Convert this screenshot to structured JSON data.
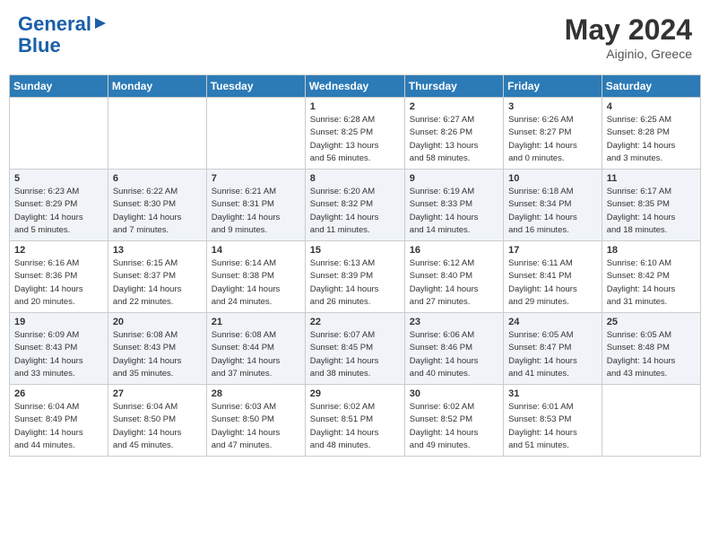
{
  "header": {
    "logo_text_general": "General",
    "logo_text_blue": "Blue",
    "month_year": "May 2024",
    "location": "Aiginio, Greece"
  },
  "weekdays": [
    "Sunday",
    "Monday",
    "Tuesday",
    "Wednesday",
    "Thursday",
    "Friday",
    "Saturday"
  ],
  "weeks": [
    [
      {
        "day": "",
        "info": ""
      },
      {
        "day": "",
        "info": ""
      },
      {
        "day": "",
        "info": ""
      },
      {
        "day": "1",
        "info": "Sunrise: 6:28 AM\nSunset: 8:25 PM\nDaylight: 13 hours\nand 56 minutes."
      },
      {
        "day": "2",
        "info": "Sunrise: 6:27 AM\nSunset: 8:26 PM\nDaylight: 13 hours\nand 58 minutes."
      },
      {
        "day": "3",
        "info": "Sunrise: 6:26 AM\nSunset: 8:27 PM\nDaylight: 14 hours\nand 0 minutes."
      },
      {
        "day": "4",
        "info": "Sunrise: 6:25 AM\nSunset: 8:28 PM\nDaylight: 14 hours\nand 3 minutes."
      }
    ],
    [
      {
        "day": "5",
        "info": "Sunrise: 6:23 AM\nSunset: 8:29 PM\nDaylight: 14 hours\nand 5 minutes."
      },
      {
        "day": "6",
        "info": "Sunrise: 6:22 AM\nSunset: 8:30 PM\nDaylight: 14 hours\nand 7 minutes."
      },
      {
        "day": "7",
        "info": "Sunrise: 6:21 AM\nSunset: 8:31 PM\nDaylight: 14 hours\nand 9 minutes."
      },
      {
        "day": "8",
        "info": "Sunrise: 6:20 AM\nSunset: 8:32 PM\nDaylight: 14 hours\nand 11 minutes."
      },
      {
        "day": "9",
        "info": "Sunrise: 6:19 AM\nSunset: 8:33 PM\nDaylight: 14 hours\nand 14 minutes."
      },
      {
        "day": "10",
        "info": "Sunrise: 6:18 AM\nSunset: 8:34 PM\nDaylight: 14 hours\nand 16 minutes."
      },
      {
        "day": "11",
        "info": "Sunrise: 6:17 AM\nSunset: 8:35 PM\nDaylight: 14 hours\nand 18 minutes."
      }
    ],
    [
      {
        "day": "12",
        "info": "Sunrise: 6:16 AM\nSunset: 8:36 PM\nDaylight: 14 hours\nand 20 minutes."
      },
      {
        "day": "13",
        "info": "Sunrise: 6:15 AM\nSunset: 8:37 PM\nDaylight: 14 hours\nand 22 minutes."
      },
      {
        "day": "14",
        "info": "Sunrise: 6:14 AM\nSunset: 8:38 PM\nDaylight: 14 hours\nand 24 minutes."
      },
      {
        "day": "15",
        "info": "Sunrise: 6:13 AM\nSunset: 8:39 PM\nDaylight: 14 hours\nand 26 minutes."
      },
      {
        "day": "16",
        "info": "Sunrise: 6:12 AM\nSunset: 8:40 PM\nDaylight: 14 hours\nand 27 minutes."
      },
      {
        "day": "17",
        "info": "Sunrise: 6:11 AM\nSunset: 8:41 PM\nDaylight: 14 hours\nand 29 minutes."
      },
      {
        "day": "18",
        "info": "Sunrise: 6:10 AM\nSunset: 8:42 PM\nDaylight: 14 hours\nand 31 minutes."
      }
    ],
    [
      {
        "day": "19",
        "info": "Sunrise: 6:09 AM\nSunset: 8:43 PM\nDaylight: 14 hours\nand 33 minutes."
      },
      {
        "day": "20",
        "info": "Sunrise: 6:08 AM\nSunset: 8:43 PM\nDaylight: 14 hours\nand 35 minutes."
      },
      {
        "day": "21",
        "info": "Sunrise: 6:08 AM\nSunset: 8:44 PM\nDaylight: 14 hours\nand 37 minutes."
      },
      {
        "day": "22",
        "info": "Sunrise: 6:07 AM\nSunset: 8:45 PM\nDaylight: 14 hours\nand 38 minutes."
      },
      {
        "day": "23",
        "info": "Sunrise: 6:06 AM\nSunset: 8:46 PM\nDaylight: 14 hours\nand 40 minutes."
      },
      {
        "day": "24",
        "info": "Sunrise: 6:05 AM\nSunset: 8:47 PM\nDaylight: 14 hours\nand 41 minutes."
      },
      {
        "day": "25",
        "info": "Sunrise: 6:05 AM\nSunset: 8:48 PM\nDaylight: 14 hours\nand 43 minutes."
      }
    ],
    [
      {
        "day": "26",
        "info": "Sunrise: 6:04 AM\nSunset: 8:49 PM\nDaylight: 14 hours\nand 44 minutes."
      },
      {
        "day": "27",
        "info": "Sunrise: 6:04 AM\nSunset: 8:50 PM\nDaylight: 14 hours\nand 45 minutes."
      },
      {
        "day": "28",
        "info": "Sunrise: 6:03 AM\nSunset: 8:50 PM\nDaylight: 14 hours\nand 47 minutes."
      },
      {
        "day": "29",
        "info": "Sunrise: 6:02 AM\nSunset: 8:51 PM\nDaylight: 14 hours\nand 48 minutes."
      },
      {
        "day": "30",
        "info": "Sunrise: 6:02 AM\nSunset: 8:52 PM\nDaylight: 14 hours\nand 49 minutes."
      },
      {
        "day": "31",
        "info": "Sunrise: 6:01 AM\nSunset: 8:53 PM\nDaylight: 14 hours\nand 51 minutes."
      },
      {
        "day": "",
        "info": ""
      }
    ]
  ]
}
